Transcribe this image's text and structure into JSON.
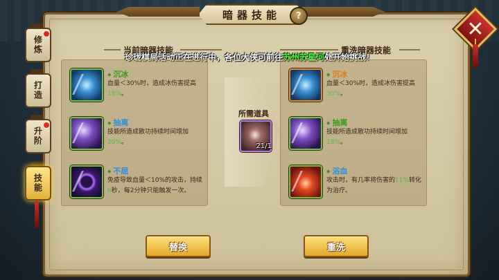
{
  "window": {
    "title": "暗器技能",
    "help_label": "?",
    "close_label": "✕"
  },
  "side_tabs": [
    {
      "label": "修炼",
      "active": false,
      "has_alert": true
    },
    {
      "label": "打造",
      "active": false,
      "has_alert": false
    },
    {
      "label": "升阶",
      "active": false,
      "has_alert": true
    },
    {
      "label": "技能",
      "active": true,
      "has_alert": false
    }
  ],
  "notice": {
    "before": "珍珑棋局活动正在进行中，各位大侠可前往",
    "highlight": "苏州苏星河",
    "after": "处开始挑战！"
  },
  "current": {
    "title": "当前暗器技能",
    "skills": [
      {
        "name": "沉冰",
        "desc_before": "血量＜30%时，造成冰伤害提高",
        "desc_value": "18%",
        "desc_after": "。",
        "icon": "ice-dart-icon"
      },
      {
        "name": "抽离",
        "desc_before": "技能所造成散功持续时间增加",
        "desc_value": "20%",
        "desc_after": "。",
        "icon": "claw-dart-icon"
      },
      {
        "name": "不屈",
        "desc_before": "免疫导致血量＜10%的攻击，持续",
        "desc_value": "6",
        "desc_after": "秒，每2分钟只能触发一次。",
        "icon": "purple-ring-icon"
      }
    ]
  },
  "reset": {
    "title": "重洗暗器技能",
    "skills": [
      {
        "name": "沉冰",
        "desc_before": "血量＜30%时，造成冰伤害提高",
        "desc_value": "30%",
        "desc_after": "。",
        "icon": "ice-dart-icon"
      },
      {
        "name": "抽离",
        "desc_before": "技能所造成散功持续时间增加",
        "desc_value": "18%",
        "desc_after": "。",
        "icon": "claw-dart-icon"
      },
      {
        "name": "浴血",
        "desc_before": "攻击时，有几率将伤害的",
        "desc_value": "11%",
        "desc_after": "转化为治疗。",
        "icon": "blood-palm-icon"
      }
    ]
  },
  "required_item": {
    "label": "所需道具",
    "count": "21/1",
    "icon": "stone-item-icon"
  },
  "buttons": {
    "replace": "替换",
    "reset": "重洗"
  },
  "colors": {
    "skill_blue": "#2f8fd8",
    "skill_orange": "#e07a1a",
    "skill_green": "#3c9a1e",
    "value_green": "#5cb84a",
    "notice_highlight": "#4bff3a"
  }
}
